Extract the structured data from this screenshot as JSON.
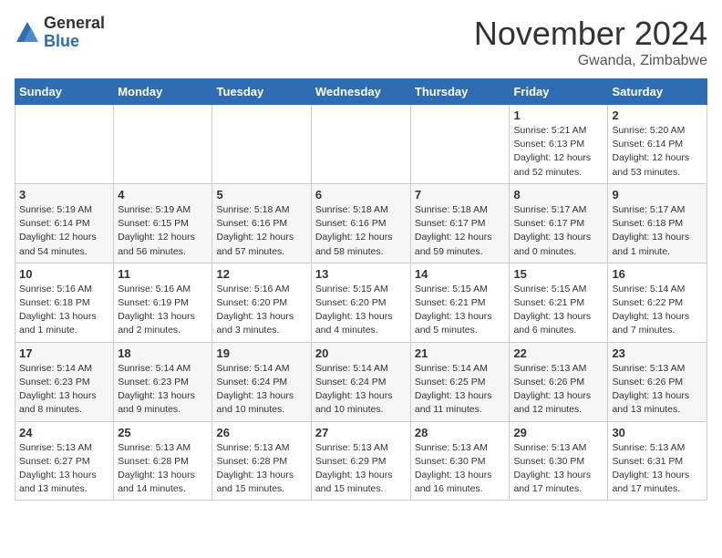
{
  "logo": {
    "general": "General",
    "blue": "Blue"
  },
  "title": "November 2024",
  "location": "Gwanda, Zimbabwe",
  "days_of_week": [
    "Sunday",
    "Monday",
    "Tuesday",
    "Wednesday",
    "Thursday",
    "Friday",
    "Saturday"
  ],
  "weeks": [
    [
      {
        "day": "",
        "info": ""
      },
      {
        "day": "",
        "info": ""
      },
      {
        "day": "",
        "info": ""
      },
      {
        "day": "",
        "info": ""
      },
      {
        "day": "",
        "info": ""
      },
      {
        "day": "1",
        "info": "Sunrise: 5:21 AM\nSunset: 6:13 PM\nDaylight: 12 hours\nand 52 minutes."
      },
      {
        "day": "2",
        "info": "Sunrise: 5:20 AM\nSunset: 6:14 PM\nDaylight: 12 hours\nand 53 minutes."
      }
    ],
    [
      {
        "day": "3",
        "info": "Sunrise: 5:19 AM\nSunset: 6:14 PM\nDaylight: 12 hours\nand 54 minutes."
      },
      {
        "day": "4",
        "info": "Sunrise: 5:19 AM\nSunset: 6:15 PM\nDaylight: 12 hours\nand 56 minutes."
      },
      {
        "day": "5",
        "info": "Sunrise: 5:18 AM\nSunset: 6:16 PM\nDaylight: 12 hours\nand 57 minutes."
      },
      {
        "day": "6",
        "info": "Sunrise: 5:18 AM\nSunset: 6:16 PM\nDaylight: 12 hours\nand 58 minutes."
      },
      {
        "day": "7",
        "info": "Sunrise: 5:18 AM\nSunset: 6:17 PM\nDaylight: 12 hours\nand 59 minutes."
      },
      {
        "day": "8",
        "info": "Sunrise: 5:17 AM\nSunset: 6:17 PM\nDaylight: 13 hours\nand 0 minutes."
      },
      {
        "day": "9",
        "info": "Sunrise: 5:17 AM\nSunset: 6:18 PM\nDaylight: 13 hours\nand 1 minute."
      }
    ],
    [
      {
        "day": "10",
        "info": "Sunrise: 5:16 AM\nSunset: 6:18 PM\nDaylight: 13 hours\nand 1 minute."
      },
      {
        "day": "11",
        "info": "Sunrise: 5:16 AM\nSunset: 6:19 PM\nDaylight: 13 hours\nand 2 minutes."
      },
      {
        "day": "12",
        "info": "Sunrise: 5:16 AM\nSunset: 6:20 PM\nDaylight: 13 hours\nand 3 minutes."
      },
      {
        "day": "13",
        "info": "Sunrise: 5:15 AM\nSunset: 6:20 PM\nDaylight: 13 hours\nand 4 minutes."
      },
      {
        "day": "14",
        "info": "Sunrise: 5:15 AM\nSunset: 6:21 PM\nDaylight: 13 hours\nand 5 minutes."
      },
      {
        "day": "15",
        "info": "Sunrise: 5:15 AM\nSunset: 6:21 PM\nDaylight: 13 hours\nand 6 minutes."
      },
      {
        "day": "16",
        "info": "Sunrise: 5:14 AM\nSunset: 6:22 PM\nDaylight: 13 hours\nand 7 minutes."
      }
    ],
    [
      {
        "day": "17",
        "info": "Sunrise: 5:14 AM\nSunset: 6:23 PM\nDaylight: 13 hours\nand 8 minutes."
      },
      {
        "day": "18",
        "info": "Sunrise: 5:14 AM\nSunset: 6:23 PM\nDaylight: 13 hours\nand 9 minutes."
      },
      {
        "day": "19",
        "info": "Sunrise: 5:14 AM\nSunset: 6:24 PM\nDaylight: 13 hours\nand 10 minutes."
      },
      {
        "day": "20",
        "info": "Sunrise: 5:14 AM\nSunset: 6:24 PM\nDaylight: 13 hours\nand 10 minutes."
      },
      {
        "day": "21",
        "info": "Sunrise: 5:14 AM\nSunset: 6:25 PM\nDaylight: 13 hours\nand 11 minutes."
      },
      {
        "day": "22",
        "info": "Sunrise: 5:13 AM\nSunset: 6:26 PM\nDaylight: 13 hours\nand 12 minutes."
      },
      {
        "day": "23",
        "info": "Sunrise: 5:13 AM\nSunset: 6:26 PM\nDaylight: 13 hours\nand 13 minutes."
      }
    ],
    [
      {
        "day": "24",
        "info": "Sunrise: 5:13 AM\nSunset: 6:27 PM\nDaylight: 13 hours\nand 13 minutes."
      },
      {
        "day": "25",
        "info": "Sunrise: 5:13 AM\nSunset: 6:28 PM\nDaylight: 13 hours\nand 14 minutes."
      },
      {
        "day": "26",
        "info": "Sunrise: 5:13 AM\nSunset: 6:28 PM\nDaylight: 13 hours\nand 15 minutes."
      },
      {
        "day": "27",
        "info": "Sunrise: 5:13 AM\nSunset: 6:29 PM\nDaylight: 13 hours\nand 15 minutes."
      },
      {
        "day": "28",
        "info": "Sunrise: 5:13 AM\nSunset: 6:30 PM\nDaylight: 13 hours\nand 16 minutes."
      },
      {
        "day": "29",
        "info": "Sunrise: 5:13 AM\nSunset: 6:30 PM\nDaylight: 13 hours\nand 17 minutes."
      },
      {
        "day": "30",
        "info": "Sunrise: 5:13 AM\nSunset: 6:31 PM\nDaylight: 13 hours\nand 17 minutes."
      }
    ]
  ]
}
